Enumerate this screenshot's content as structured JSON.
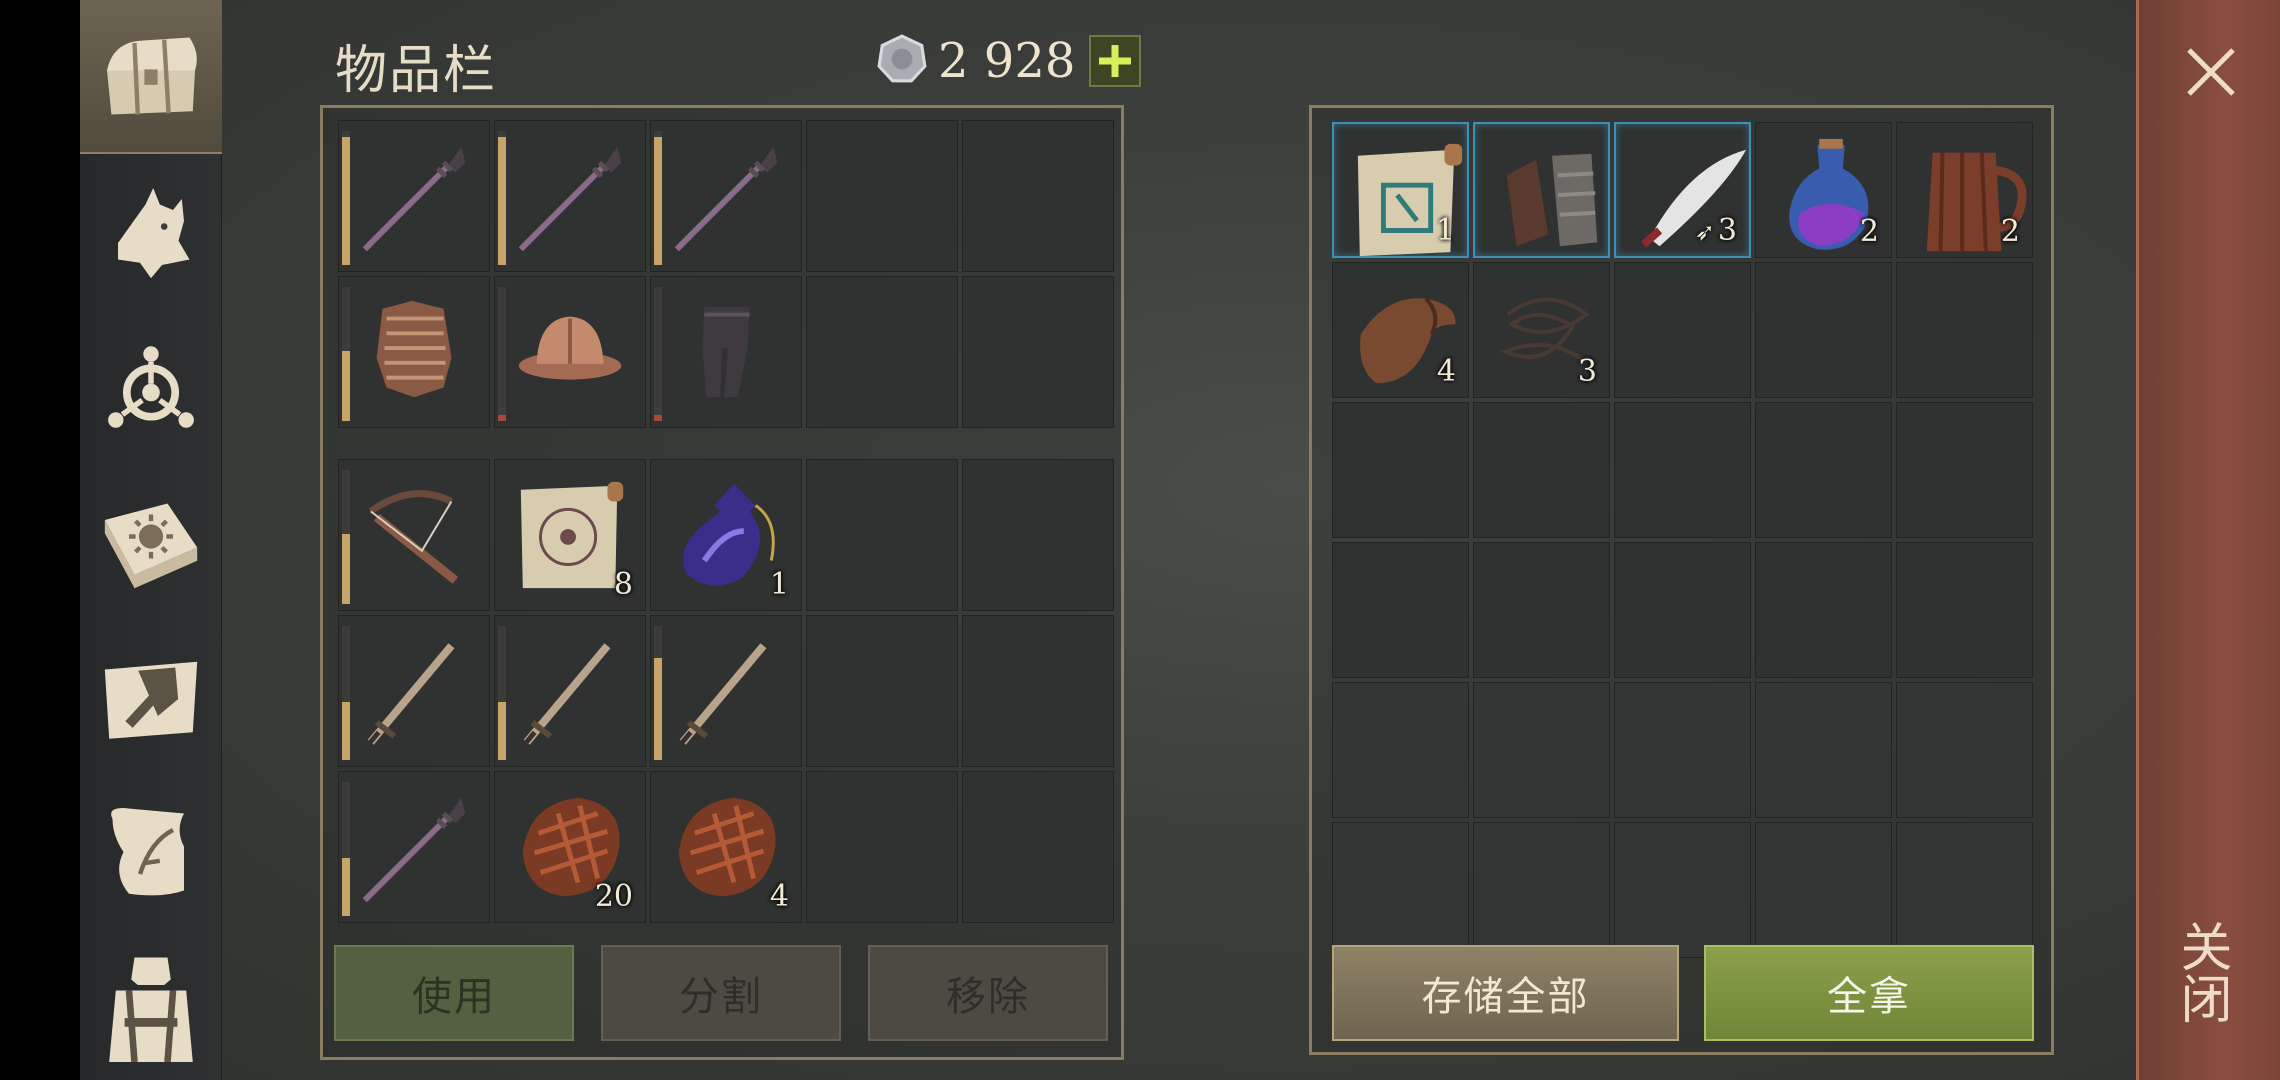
{
  "title": "物品栏",
  "currency": {
    "icon": "silver-coin-icon",
    "amount": "2 928",
    "add_icon": "plus-icon"
  },
  "sidebar": [
    {
      "icon": "chest-icon",
      "active": true
    },
    {
      "icon": "wolf-icon",
      "active": false
    },
    {
      "icon": "skills-emblem-icon",
      "active": false
    },
    {
      "icon": "sun-book-icon",
      "active": false
    },
    {
      "icon": "map-hammer-icon",
      "active": false
    },
    {
      "icon": "quest-scroll-icon",
      "active": false
    },
    {
      "icon": "character-icon",
      "active": false
    }
  ],
  "inventory": {
    "equipment_rows": [
      [
        {
          "item": "spear-icon",
          "durability": 1.0
        },
        {
          "item": "spear-icon",
          "durability": 1.0
        },
        {
          "item": "spear-icon",
          "durability": 1.0
        },
        null,
        null
      ],
      [
        {
          "item": "chainmail-icon",
          "durability": 0.55
        },
        {
          "item": "kettle-helmet-icon",
          "durability": 0.05
        },
        {
          "item": "leggings-icon",
          "durability": 0.05
        },
        null,
        null
      ]
    ],
    "bag_rows": [
      [
        {
          "item": "crossbow-icon",
          "durability": 0.55
        },
        {
          "item": "rune-scroll-icon",
          "count": "8"
        },
        {
          "item": "potion-bottle-icon",
          "count": "1"
        },
        null,
        null
      ],
      [
        {
          "item": "sword-icon",
          "durability": 0.45
        },
        {
          "item": "sword-icon",
          "durability": 0.45
        },
        {
          "item": "sword-icon",
          "durability": 0.8
        },
        null,
        null
      ],
      [
        {
          "item": "spear-icon",
          "durability": 0.45
        },
        {
          "item": "meat-steak-icon",
          "count": "20"
        },
        {
          "item": "meat-steak-icon",
          "count": "4"
        },
        null,
        null
      ]
    ],
    "buttons": {
      "use": "使用",
      "split": "分割",
      "remove": "移除"
    }
  },
  "container": {
    "rows": [
      [
        {
          "item": "scroll-map-icon",
          "count": "1",
          "highlight": true
        },
        {
          "item": "gauntlets-icon",
          "count": "",
          "highlight": true
        },
        {
          "item": "scimitar-icon",
          "count": "3",
          "highlight": true,
          "count_prefix_icon": "arrow-icon"
        },
        {
          "item": "purple-potion-icon",
          "count": "2"
        },
        {
          "item": "wooden-mug-icon",
          "count": "2"
        }
      ],
      [
        {
          "item": "leather-icon",
          "count": "4"
        },
        {
          "item": "rope-icon",
          "count": "3"
        },
        null,
        null,
        null
      ],
      [
        null,
        null,
        null,
        null,
        null
      ],
      [
        null,
        null,
        null,
        null,
        null
      ],
      [
        null,
        null,
        null,
        null,
        null
      ],
      [
        null,
        null,
        null,
        null,
        null
      ]
    ],
    "buttons": {
      "store_all": "存储全部",
      "take_all": "全拿"
    }
  },
  "close": {
    "icon": "close-icon",
    "label": "关闭"
  },
  "colors": {
    "gold": "#c7a468",
    "green_button": "#7b9440",
    "close_bar": "#7e4838"
  }
}
